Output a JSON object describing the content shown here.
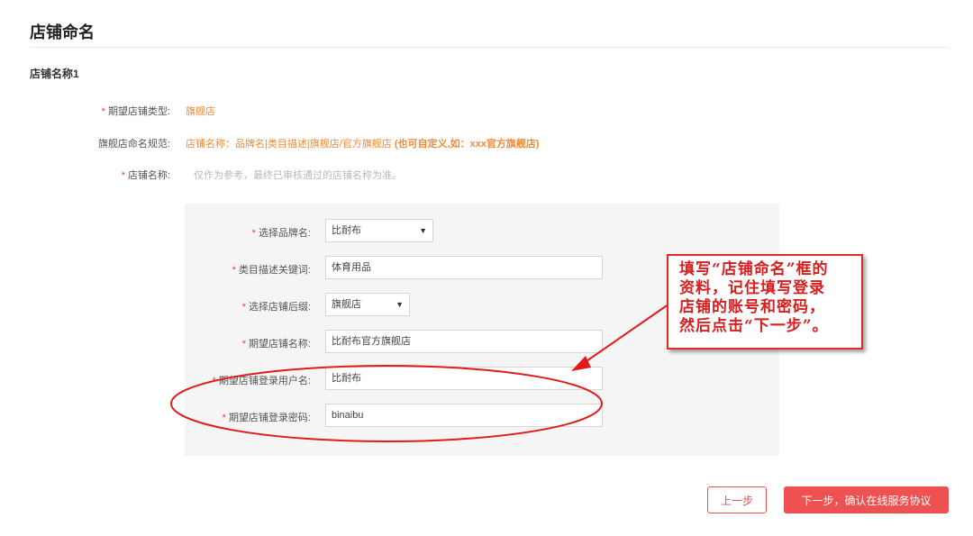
{
  "page_title": "店铺命名",
  "section_title": "店铺名称1",
  "info_rows": {
    "store_type": {
      "label": "期望店铺类型:",
      "value": "旗舰店"
    },
    "naming_rule": {
      "label": "旗舰店命名规范:",
      "value": "店铺名称：品牌名|类目描述|旗舰店/官方旗舰店",
      "note": "(也可自定义,如：xxx官方旗舰店)"
    },
    "store_name": {
      "label": "店铺名称:",
      "hint": "仅作为参考，最终已审核通过的店铺名称为准。"
    }
  },
  "form": {
    "brand": {
      "label": "选择品牌名:",
      "value": "比耐布"
    },
    "category_keyword": {
      "label": "类目描述关键词:",
      "value": "体育用品"
    },
    "suffix": {
      "label": "选择店铺后缀:",
      "value": "旗舰店"
    },
    "expected_name": {
      "label": "期望店铺名称:",
      "value": "比耐布官方旗舰店"
    },
    "login_username": {
      "label": "期望店铺登录用户名:",
      "value": "比耐布"
    },
    "login_password": {
      "label": "期望店铺登录密码:",
      "value": "binaibu"
    }
  },
  "annotation": {
    "line1": "填写“店铺命名”框的",
    "line2": "资料，记住填写登录",
    "line3": "店铺的账号和密码，",
    "line4": "然后点击“下一步”。"
  },
  "buttons": {
    "prev": "上一步",
    "next": "下一步，确认在线服务协议"
  },
  "colors": {
    "accent_red": "#ee5151",
    "annotation_red": "#e02a2a",
    "orange_text": "#f08a3a"
  }
}
